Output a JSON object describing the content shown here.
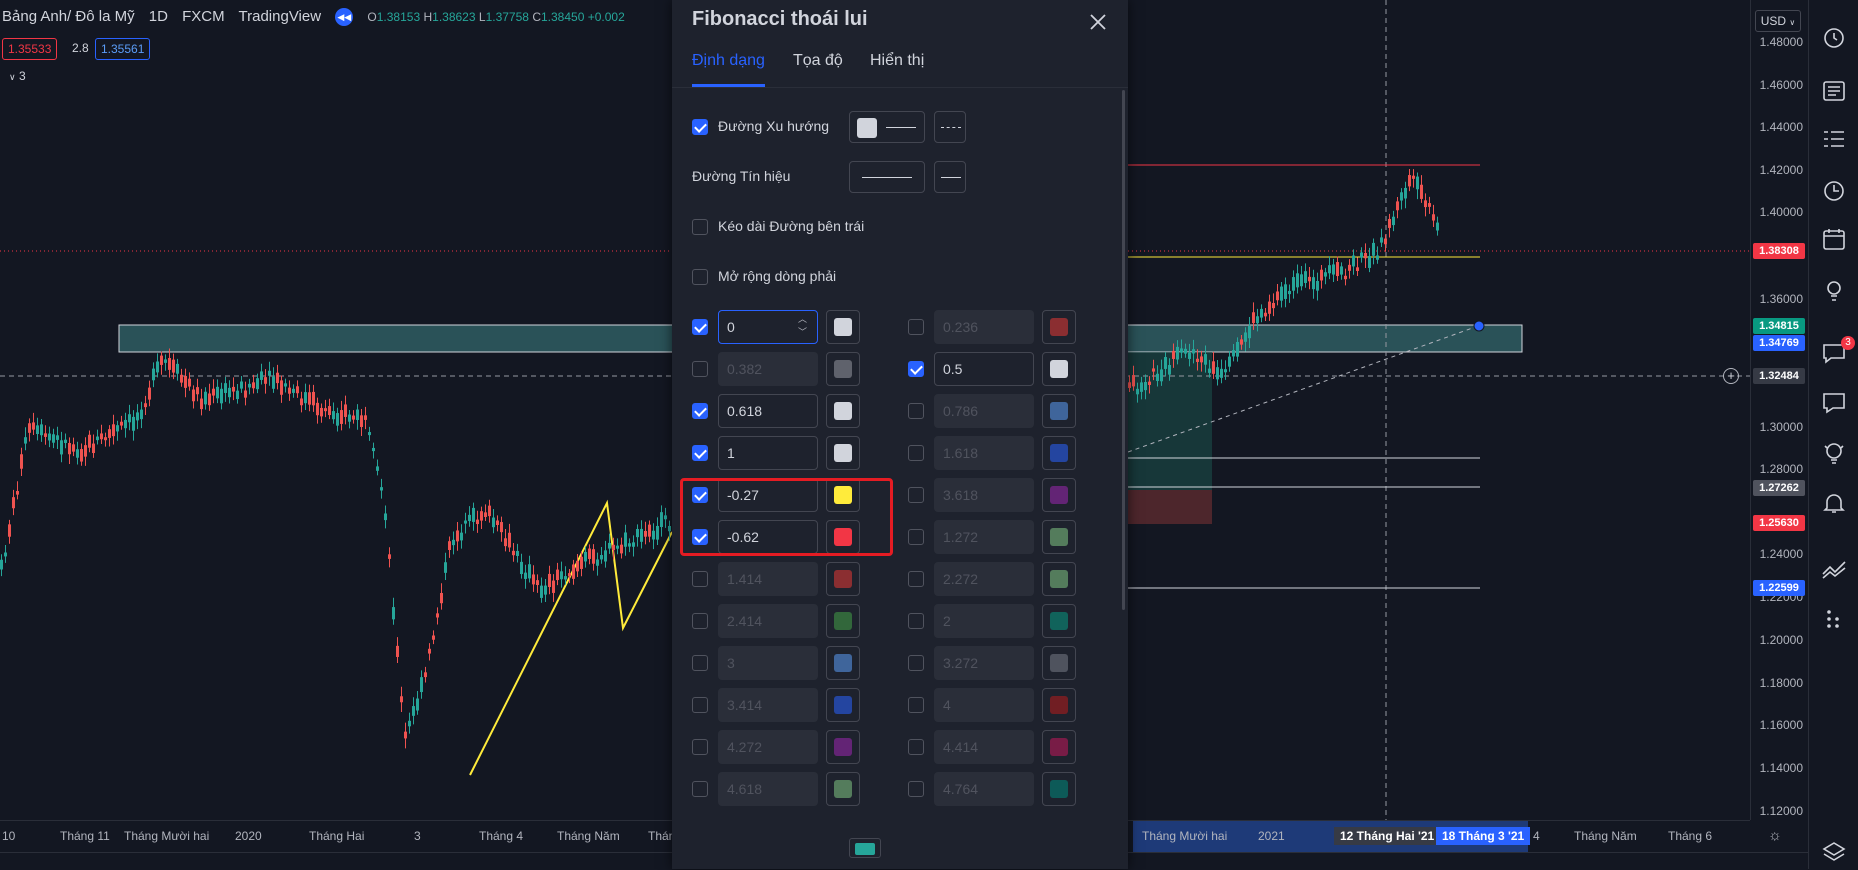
{
  "legend": {
    "symbol": "Bảng Anh/ Đô la Mỹ",
    "interval": "1D",
    "exchange": "FXCM",
    "source": "TradingView",
    "o_label": "O",
    "o": "1.38153",
    "h_label": "H",
    "h": "1.38623",
    "l_label": "L",
    "l": "1.37758",
    "c_label": "C",
    "c": "1.38450",
    "change": "+0.002",
    "sell_price": "1.35533",
    "spread": "2.8",
    "buy_price": "1.35561",
    "indicator_count": "3"
  },
  "price_axis": {
    "currency": "USD",
    "ticks": [
      "1.48000",
      "1.46000",
      "1.44000",
      "1.42000",
      "1.40000",
      "1.36000",
      "1.30000",
      "1.28000",
      "1.24000",
      "1.22000",
      "1.20000",
      "1.18000",
      "1.16000",
      "1.14000",
      "1.12000"
    ],
    "tags": [
      {
        "value": "1.38308",
        "color": "#f23645"
      },
      {
        "value": "1.34815",
        "color": "#089981"
      },
      {
        "value": "1.34769",
        "color": "#2962ff"
      },
      {
        "value": "1.32484",
        "color": "#363a45"
      },
      {
        "value": "1.27262",
        "color": "#50535e"
      },
      {
        "value": "1.25630",
        "color": "#f23645"
      },
      {
        "value": "1.22599",
        "color": "#2962ff"
      }
    ]
  },
  "time_axis": {
    "labels_left": [
      "10",
      "Tháng 11",
      "Tháng Mười hai",
      "2020",
      "Tháng Hai",
      "3",
      "Tháng 4",
      "Tháng Năm",
      "Thán"
    ],
    "labels_right": [
      "Tháng Mười hai",
      "2021",
      "Tháng Năm",
      "Tháng 6"
    ],
    "crosshair_date": "12 Tháng Hai '21",
    "range_date": "18 Tháng 3 '21",
    "partial": "4"
  },
  "right_toolbar": {
    "icons": [
      "alarm-clock-icon",
      "news-icon",
      "watchlist-icon",
      "clock-icon",
      "calendar-icon",
      "ideas-icon",
      "chat-icon",
      "comments-icon",
      "lightbulb-icon",
      "bell-icon",
      "trend-icon",
      "dots-icon",
      "layers-icon"
    ],
    "chat_badge": "3"
  },
  "dialog": {
    "title": "Fibonacci thoái lui",
    "tabs": [
      "Định dạng",
      "Tọa độ",
      "Hiển thị"
    ],
    "options": {
      "trend_line": "Đường Xu hướng",
      "signal_line": "Đường Tín hiệu",
      "extend_left": "Kéo dài Đường bên trái",
      "extend_right": "Mở rộng dòng phải"
    },
    "levels_left": [
      {
        "value": "0",
        "checked": true,
        "color": "#d1d4dc"
      },
      {
        "value": "0.382",
        "checked": false,
        "color": "#9598a1"
      },
      {
        "value": "0.618",
        "checked": true,
        "color": "#d1d4dc"
      },
      {
        "value": "1",
        "checked": true,
        "color": "#d1d4dc"
      },
      {
        "value": "-0.27",
        "checked": true,
        "color": "#ffeb3b"
      },
      {
        "value": "-0.62",
        "checked": true,
        "color": "#f23645"
      },
      {
        "value": "1.414",
        "checked": false,
        "color": "#e53935"
      },
      {
        "value": "2.414",
        "checked": false,
        "color": "#43a047"
      },
      {
        "value": "3",
        "checked": false,
        "color": "#5b9cf6"
      },
      {
        "value": "3.414",
        "checked": false,
        "color": "#2962ff"
      },
      {
        "value": "4.272",
        "checked": false,
        "color": "#9c27b0"
      },
      {
        "value": "4.618",
        "checked": false,
        "color": "#81c784"
      }
    ],
    "levels_right": [
      {
        "value": "0.236",
        "checked": false,
        "color": "#e53935"
      },
      {
        "value": "0.5",
        "checked": true,
        "color": "#d1d4dc"
      },
      {
        "value": "0.786",
        "checked": false,
        "color": "#5b9cf6"
      },
      {
        "value": "1.618",
        "checked": false,
        "color": "#2962ff"
      },
      {
        "value": "3.618",
        "checked": false,
        "color": "#9c27b0"
      },
      {
        "value": "1.272",
        "checked": false,
        "color": "#81c784"
      },
      {
        "value": "2.272",
        "checked": false,
        "color": "#81c784"
      },
      {
        "value": "2",
        "checked": false,
        "color": "#089981"
      },
      {
        "value": "3.272",
        "checked": false,
        "color": "#787b86"
      },
      {
        "value": "4",
        "checked": false,
        "color": "#b71c1c"
      },
      {
        "value": "4.414",
        "checked": false,
        "color": "#c2185b"
      },
      {
        "value": "4.764",
        "checked": false,
        "color": "#00897b"
      }
    ]
  }
}
